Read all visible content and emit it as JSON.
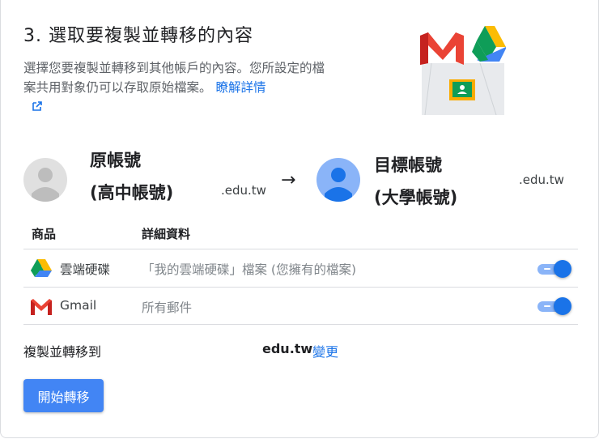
{
  "step": {
    "title": "3. 選取要複製並轉移的內容"
  },
  "description": {
    "text": "選擇您要複製並轉移到其他帳戶的內容。您所設定的檔案共用對象仍可以存取原始檔案。",
    "learn_more": "瞭解詳情"
  },
  "source": {
    "title_line1": "原帳號",
    "title_line2": "(高中帳號)",
    "domain": ".edu.tw"
  },
  "target": {
    "title_line1": "目標帳號",
    "title_line2": "(大學帳號)",
    "domain": ".edu.tw"
  },
  "table": {
    "headers": {
      "product": "商品",
      "details": "詳細資料"
    },
    "rows": [
      {
        "icon": "google-drive-icon",
        "name": "雲端硬碟",
        "detail": "「我的雲端硬碟」檔案 (您擁有的檔案)",
        "enabled": true
      },
      {
        "icon": "gmail-icon",
        "name": "Gmail",
        "detail": "所有郵件",
        "enabled": true
      }
    ]
  },
  "copy_to": {
    "label": "複製並轉移到",
    "domain": "edu.tw",
    "change": "變更"
  },
  "actions": {
    "start": "開始轉移"
  },
  "colors": {
    "accent": "#1a73e8",
    "button": "#4285f4",
    "toggle_track": "#8ab4f8"
  }
}
